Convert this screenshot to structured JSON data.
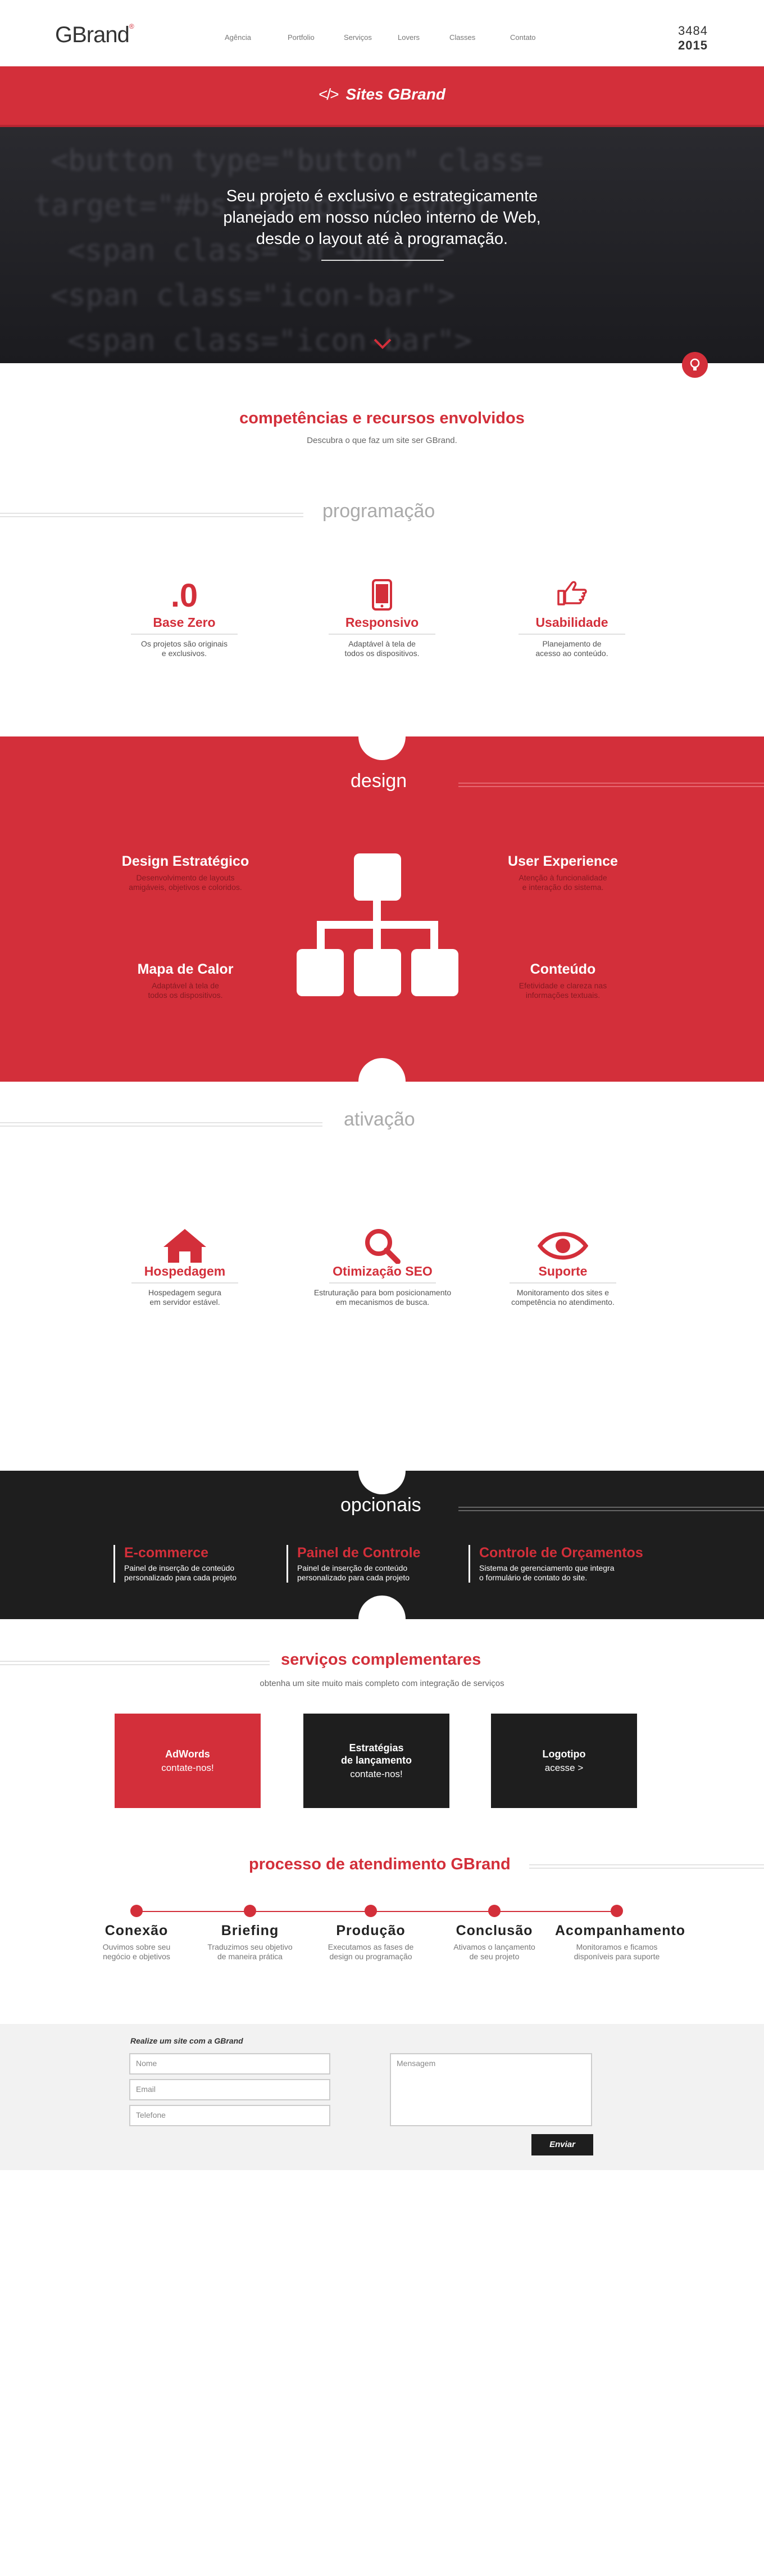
{
  "header": {
    "logo": "GBrand",
    "logo_mark": "®",
    "nav": [
      "Agência",
      "Portfolio",
      "Serviços",
      "Lovers",
      "Classes",
      "Contato"
    ],
    "counter_top": "3484",
    "counter_bottom": "2015"
  },
  "banner": {
    "icon": "code-icon",
    "title": "Sites GBrand"
  },
  "hero": {
    "lines": [
      "Seu projeto é exclusivo e estrategicamente",
      "planejado em nosso núcleo interno de Web,",
      "desde o layout até à programação."
    ]
  },
  "competencias": {
    "title": "competências e recursos envolvidos",
    "subtitle": "Descubra o que faz um site ser GBrand."
  },
  "programacao": {
    "title": "programação",
    "items": [
      {
        "icon": ".0",
        "title": "Base Zero",
        "desc": [
          "Os projetos são originais",
          "e exclusivos."
        ]
      },
      {
        "icon": "mobile-icon",
        "title": "Responsivo",
        "desc": [
          "Adaptável à tela de",
          "todos os dispositivos."
        ]
      },
      {
        "icon": "hand-pointer-icon",
        "title": "Usabilidade",
        "desc": [
          "Planejamento de",
          "acesso ao conteúdo."
        ]
      }
    ]
  },
  "design": {
    "title": "design",
    "items": [
      {
        "title": "Design Estratégico",
        "desc": [
          "Desenvolvimento de layouts",
          "amigáveis, objetivos e coloridos."
        ]
      },
      {
        "title": "User Experience",
        "desc": [
          "Atenção à funcionalidade",
          "e interação do sistema."
        ]
      },
      {
        "title": "Mapa de Calor",
        "desc": [
          "Adaptável à tela de",
          "todos os dispositivos."
        ]
      },
      {
        "title": "Conteúdo",
        "desc": [
          "Efetividade e clareza nas",
          "informações textuais."
        ]
      }
    ]
  },
  "ativacao": {
    "title": "ativação",
    "items": [
      {
        "icon": "home-icon",
        "title": "Hospedagem",
        "desc": [
          "Hospedagem segura",
          "em servidor estável."
        ]
      },
      {
        "icon": "search-icon",
        "title": "Otimização SEO",
        "desc": [
          "Estruturação para bom posicionamento",
          "em mecanismos de busca."
        ]
      },
      {
        "icon": "eye-icon",
        "title": "Suporte",
        "desc": [
          "Monitoramento dos sites e",
          "competência no atendimento."
        ]
      }
    ]
  },
  "opcionais": {
    "title": "opcionais",
    "items": [
      {
        "title": "E-commerce",
        "desc": [
          "Painel de inserção de conteúdo",
          "personalizado para cada projeto"
        ]
      },
      {
        "title": "Painel de Controle",
        "desc": [
          "Painel de inserção de conteúdo",
          "personalizado para cada projeto"
        ]
      },
      {
        "title": "Controle de Orçamentos",
        "desc": [
          "Sistema de gerenciamento que integra",
          "o formulário de contato do site."
        ]
      }
    ]
  },
  "complementares": {
    "title": "serviços complementares",
    "subtitle": "obtenha um site muito mais completo com integração de serviços",
    "boxes": [
      {
        "title": "AdWords",
        "sub": "contate-nos!",
        "color": "#d32f3a"
      },
      {
        "title": "Estratégias de lançamento",
        "title_lines": [
          "Estratégias",
          "de lançamento"
        ],
        "sub": "contate-nos!",
        "color": "#1e1e1e"
      },
      {
        "title": "Logotipo",
        "sub": "acesse >",
        "color": "#1e1e1e"
      }
    ]
  },
  "processo": {
    "title": "processo de atendimento GBrand",
    "steps": [
      {
        "title": "Conexão",
        "desc": [
          "Ouvimos sobre seu",
          "negócio e objetivos"
        ]
      },
      {
        "title": "Briefing",
        "desc": [
          "Traduzimos seu objetivo",
          "de maneira prática"
        ]
      },
      {
        "title": "Produção",
        "desc": [
          "Executamos as fases de",
          "design ou programação"
        ]
      },
      {
        "title": "Conclusão",
        "desc": [
          "Ativamos o lançamento",
          "de seu projeto"
        ]
      },
      {
        "title": "Acompanhamento",
        "desc": [
          "Monitoramos e ficamos",
          "disponíveis para suporte"
        ]
      }
    ]
  },
  "form": {
    "label": "Realize um site com a GBrand",
    "name_placeholder": "Nome",
    "email_placeholder": "Email",
    "phone_placeholder": "Telefone",
    "message_placeholder": "Mensagem",
    "submit": "Enviar"
  },
  "colors": {
    "accent": "#d32f3a",
    "dark": "#1e1e1e"
  }
}
